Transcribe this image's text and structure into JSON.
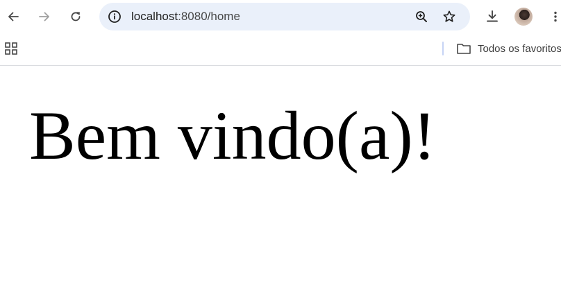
{
  "browser": {
    "url_host": "localhost",
    "url_rest": ":8080/home",
    "bookmarks_folder_label": "Todos os favoritos",
    "icons": {
      "back": "back-arrow-icon",
      "forward": "forward-arrow-icon",
      "reload": "reload-icon",
      "site_info": "info-icon",
      "zoom": "zoom-in-icon",
      "bookmark": "star-icon",
      "download": "download-icon",
      "profile": "avatar",
      "menu": "kebab-menu-icon",
      "apps": "apps-grid-icon",
      "folder": "folder-icon"
    }
  },
  "page": {
    "heading": "Bem vindo(a)!"
  },
  "colors": {
    "omnibox_bg": "#eaf0fa",
    "page_bg": "#ffffff",
    "heading_text": "#000000"
  }
}
